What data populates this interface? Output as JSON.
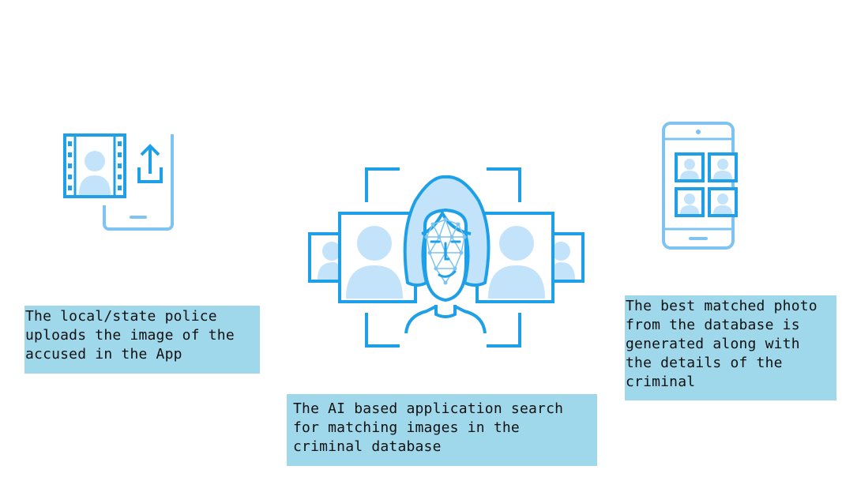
{
  "colors": {
    "stroke_blue": "#1ea0e8",
    "light_stroke": "#7fc4f0",
    "fill_light": "#c2e3fa",
    "caption_bg": "#9fd8ea"
  },
  "steps": [
    {
      "icon": "photo-upload-phone-icon",
      "caption": "The local/state police\nuploads the image of the\naccused in the App"
    },
    {
      "icon": "face-recognition-icon",
      "caption": "The AI based application search\nfor matching images in the\ncriminal database"
    },
    {
      "icon": "phone-photo-grid-icon",
      "caption": "The best matched photo\nfrom the database is\ngenerated along with\nthe details of the\ncriminal"
    }
  ]
}
